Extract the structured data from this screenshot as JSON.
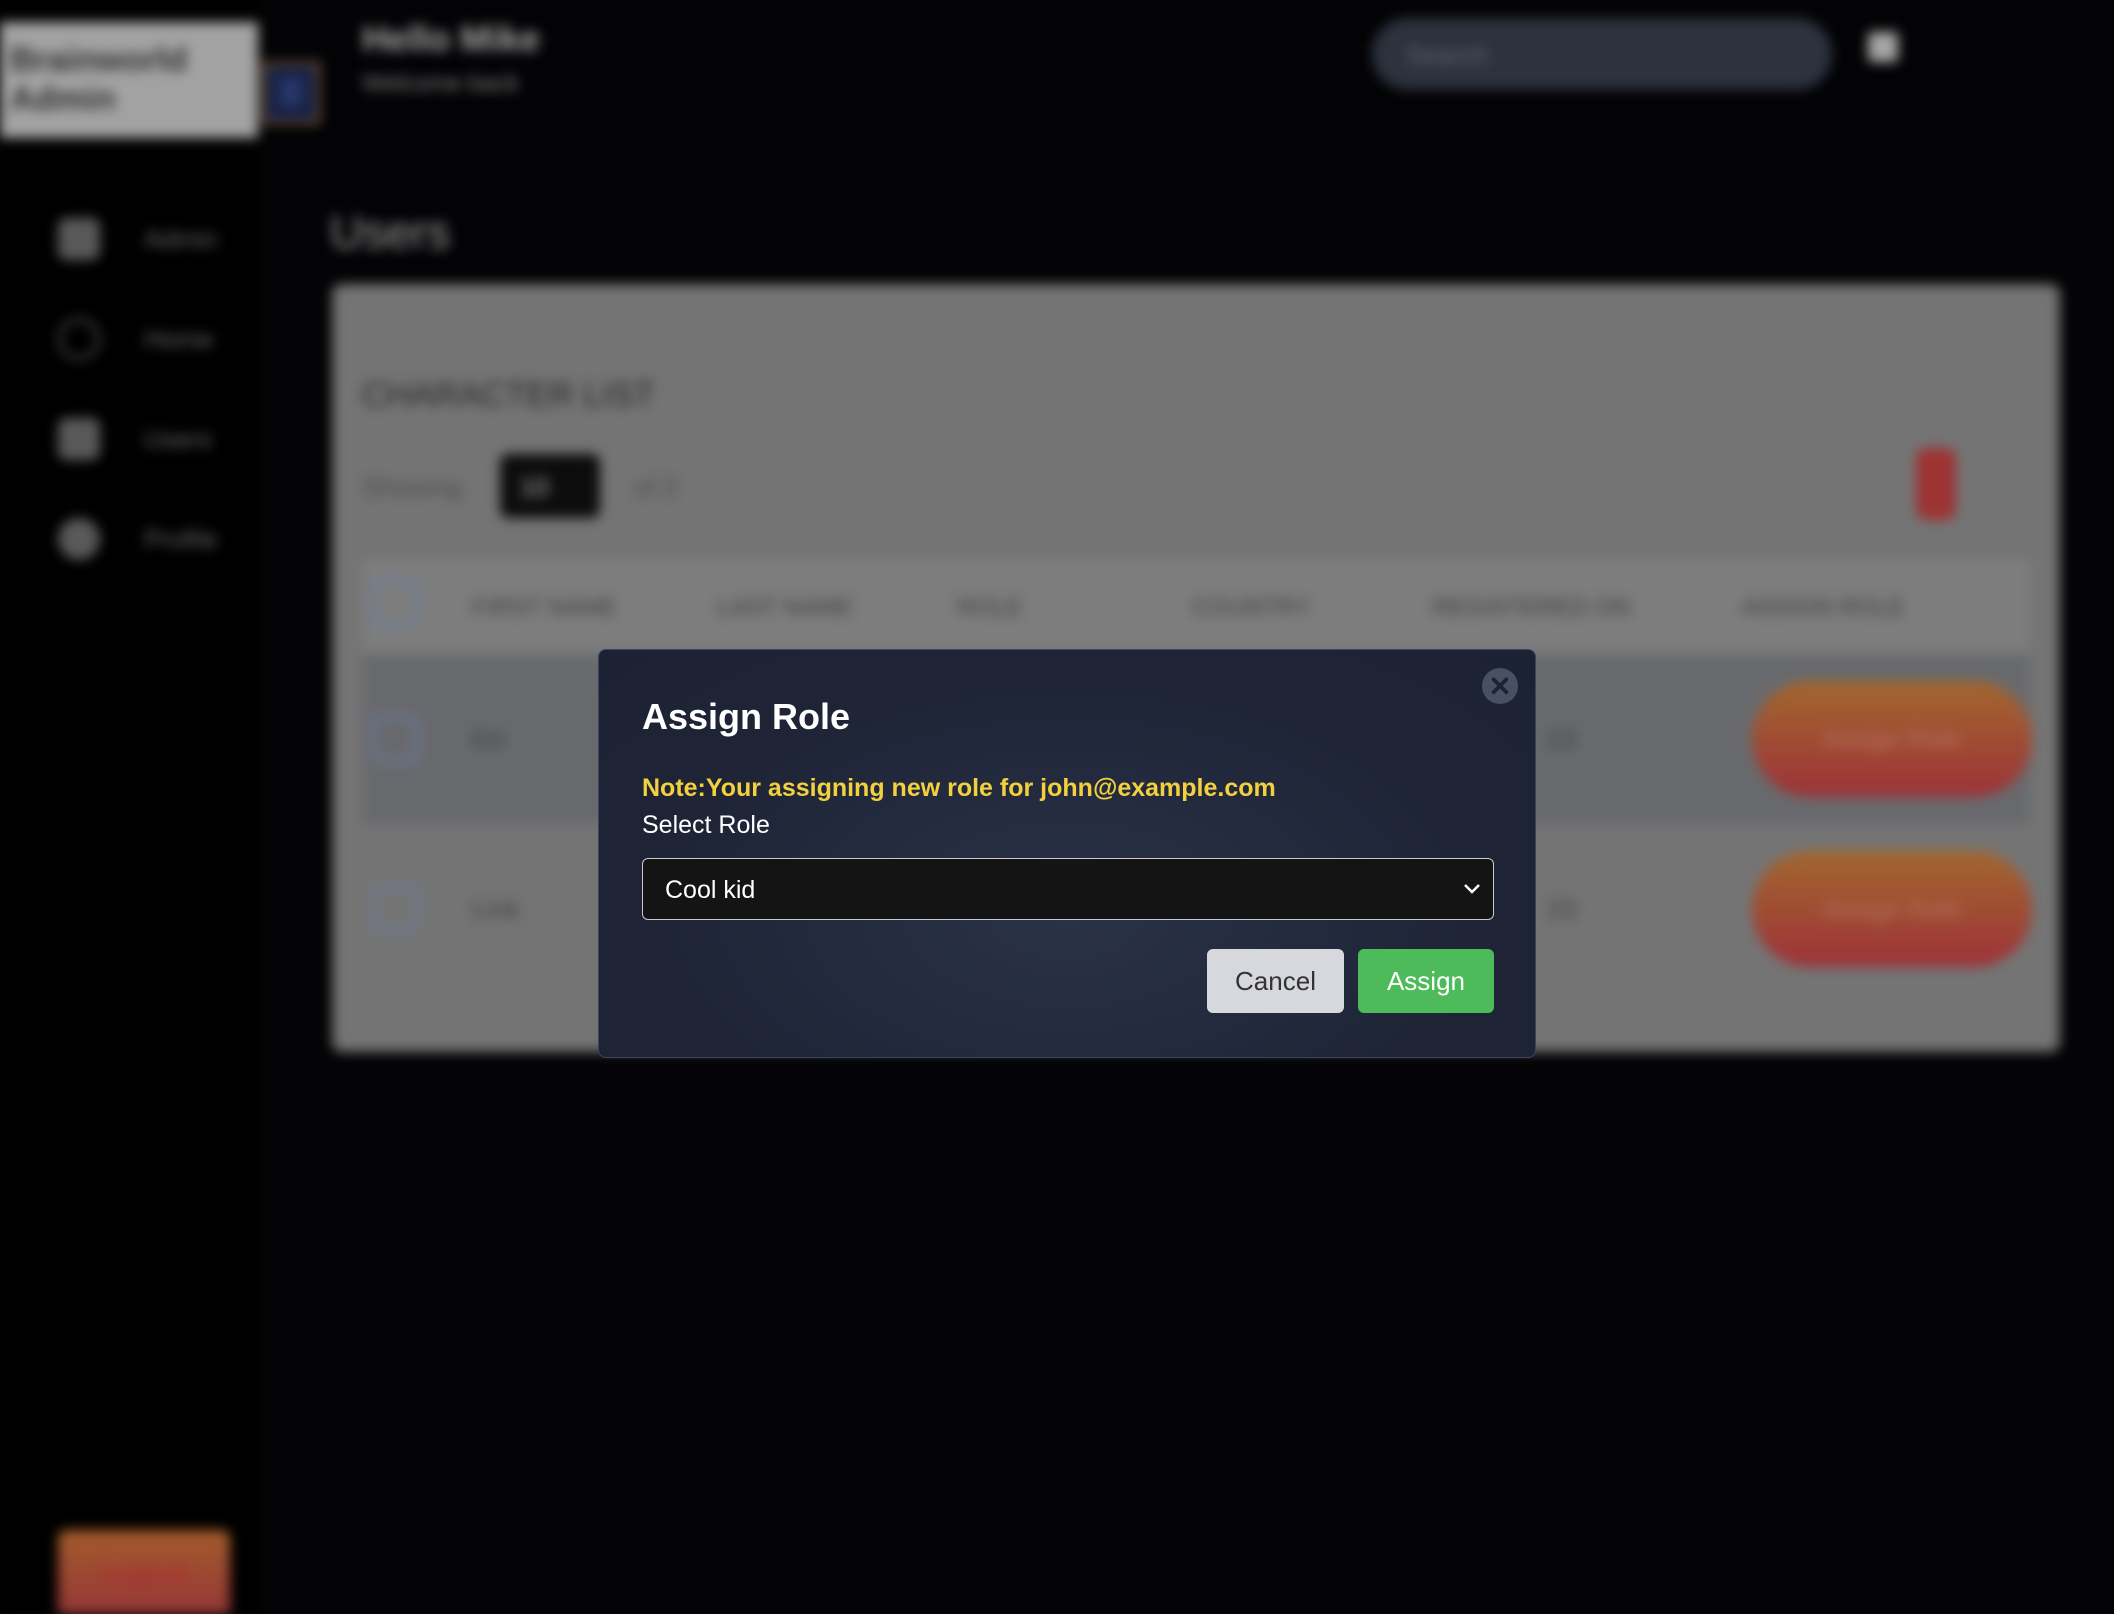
{
  "app": {
    "brand": "Brainworld Admin",
    "greeting": "Hello Mike",
    "subgreeting": "Welcome back",
    "search_placeholder": "Search",
    "page_title": "Users"
  },
  "sidebar": {
    "items": [
      {
        "label": "Admin",
        "icon": "dashboard-icon"
      },
      {
        "label": "Home",
        "icon": "home-icon"
      },
      {
        "label": "Users",
        "icon": "users-icon"
      },
      {
        "label": "Profile",
        "icon": "profile-icon"
      }
    ],
    "logout_label": "Logout"
  },
  "table": {
    "title": "CHARACTER LIST",
    "show_label": "Showing",
    "page_size": "10",
    "of_label": "of 2",
    "columns": [
      "FIRST NAME",
      "LAST NAME",
      "ROLE",
      "COUNTRY",
      "REGISTERED ON",
      "ASSIGN ROLE"
    ],
    "rows": [
      {
        "first_name": "Ed",
        "date": "23",
        "action": "Assign Role"
      },
      {
        "first_name": "Link",
        "date": "23",
        "action": "Assign Role"
      }
    ]
  },
  "modal": {
    "title": "Assign Role",
    "note": "Note:Your assigning new role for john@example.com",
    "select_label": "Select Role",
    "selected_role": "Cool kid",
    "cancel_label": "Cancel",
    "assign_label": "Assign",
    "close_symbol": "✕"
  },
  "colors": {
    "note": "#f3d03e",
    "assign": "#4dbb5a",
    "cancel": "#d6d8de",
    "modal_bg": "#1f2537"
  }
}
